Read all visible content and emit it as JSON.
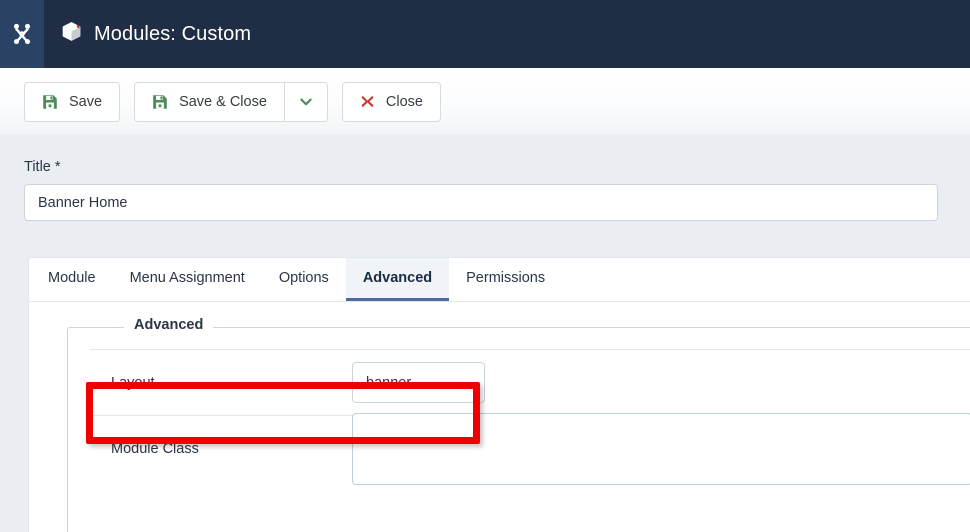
{
  "header": {
    "logo_icon": "joomla-logo-icon",
    "page_icon": "module-cube-icon",
    "title": "Modules: Custom"
  },
  "toolbar": {
    "buttons": [
      {
        "label": "Save",
        "icon": "save-floppy-icon",
        "icon_color": "#4f8a5b"
      },
      {
        "label": "Save & Close",
        "icon": "save-floppy-icon",
        "icon_color": "#4f8a5b"
      },
      {
        "label": "Close",
        "icon": "close-x-icon",
        "icon_color": "#c0392b"
      }
    ],
    "save_label": "Save",
    "save_close_label": "Save & Close",
    "close_label": "Close",
    "dropdown_icon": "chevron-down-icon",
    "dropdown_icon_color": "#4f8a5b"
  },
  "title_field": {
    "label": "Title *",
    "value": "Banner Home",
    "placeholder": ""
  },
  "tabs": [
    {
      "label": "Module",
      "active": false
    },
    {
      "label": "Menu Assignment",
      "active": false
    },
    {
      "label": "Options",
      "active": false
    },
    {
      "label": "Advanced",
      "active": true
    },
    {
      "label": "Permissions",
      "active": false
    }
  ],
  "fieldset": {
    "legend": "Advanced",
    "rows": [
      {
        "label": "Layout",
        "type": "select",
        "value": "banner",
        "highlighted": true
      },
      {
        "label": "Module Class",
        "type": "text",
        "value": "",
        "placeholder": "",
        "highlighted": false
      }
    ]
  },
  "annotation": {
    "shape": "rectangle",
    "color": "#ee0000",
    "target": "Layout"
  },
  "colors": {
    "header_bg": "#1f2e45",
    "logo_panel_bg": "#2a4263",
    "content_bg": "#eaeef3",
    "card_bg": "#ffffff",
    "active_tab_underline": "#4a6c9b",
    "text_primary": "#2a3645",
    "annotation_red": "#ee0000"
  }
}
